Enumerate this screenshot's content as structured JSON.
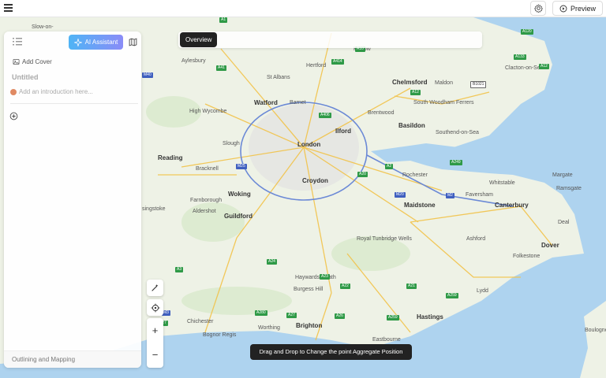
{
  "topbar": {
    "menu_icon": "hamburger-icon",
    "settings_icon": "gear-icon",
    "preview_label": "Preview",
    "preview_icon": "play-circle-icon"
  },
  "overview": {
    "label": "Overview"
  },
  "panel": {
    "outline_icon": "list-icon",
    "ai_assistant_label": "AI Assistant",
    "ai_icon": "sparkle-icon",
    "map_icon": "map-icon",
    "add_cover_label": "Add Cover",
    "title_placeholder": "Untitled",
    "intro_placeholder": "Add an introduction here...",
    "add_icon": "plus-circle-icon",
    "footer_label": "Outlining and Mapping"
  },
  "controls": {
    "draw_icon": "magic-wand-icon",
    "locate_icon": "crosshair-icon",
    "zoom_in": "+",
    "zoom_out": "−"
  },
  "tooltip": "Drag and Drop to Change the point Aggregate Position",
  "map": {
    "places": [
      {
        "name": "Aylesbury",
        "cls": ""
      },
      {
        "name": "St Albans",
        "cls": ""
      },
      {
        "name": "Hertford",
        "cls": ""
      },
      {
        "name": "Harlow",
        "cls": ""
      },
      {
        "name": "Chelmsford",
        "cls": "big"
      },
      {
        "name": "Maldon",
        "cls": ""
      },
      {
        "name": "Clacton-on-Sea",
        "cls": ""
      },
      {
        "name": "Watford",
        "cls": "big"
      },
      {
        "name": "Barnet",
        "cls": ""
      },
      {
        "name": "South Woodham Ferrers",
        "cls": ""
      },
      {
        "name": "High Wycombe",
        "cls": ""
      },
      {
        "name": "Brentwood",
        "cls": ""
      },
      {
        "name": "Ilford",
        "cls": "big"
      },
      {
        "name": "Basildon",
        "cls": "big"
      },
      {
        "name": "Southend-on-Sea",
        "cls": ""
      },
      {
        "name": "Slough",
        "cls": ""
      },
      {
        "name": "London",
        "cls": "big"
      },
      {
        "name": "Reading",
        "cls": "big"
      },
      {
        "name": "Bracknell",
        "cls": ""
      },
      {
        "name": "Croydon",
        "cls": "big"
      },
      {
        "name": "Rochester",
        "cls": ""
      },
      {
        "name": "Margate",
        "cls": ""
      },
      {
        "name": "Woking",
        "cls": "big"
      },
      {
        "name": "Whitstable",
        "cls": ""
      },
      {
        "name": "Ramsgate",
        "cls": ""
      },
      {
        "name": "Farnborough",
        "cls": ""
      },
      {
        "name": "Faversham",
        "cls": ""
      },
      {
        "name": "singstoke",
        "cls": ""
      },
      {
        "name": "Aldershot",
        "cls": ""
      },
      {
        "name": "Guildford",
        "cls": "big"
      },
      {
        "name": "Maidstone",
        "cls": "big"
      },
      {
        "name": "Canterbury",
        "cls": "big"
      },
      {
        "name": "Deal",
        "cls": ""
      },
      {
        "name": "Royal Tunbridge Wells",
        "cls": ""
      },
      {
        "name": "Ashford",
        "cls": ""
      },
      {
        "name": "Dover",
        "cls": "big"
      },
      {
        "name": "Folkestone",
        "cls": ""
      },
      {
        "name": "Haywards Heath",
        "cls": ""
      },
      {
        "name": "Burgess Hill",
        "cls": ""
      },
      {
        "name": "Lydd",
        "cls": ""
      },
      {
        "name": "Chichester",
        "cls": ""
      },
      {
        "name": "Worthing",
        "cls": ""
      },
      {
        "name": "Brighton",
        "cls": "big"
      },
      {
        "name": "Hastings",
        "cls": "big"
      },
      {
        "name": "Bognor Regis",
        "cls": ""
      },
      {
        "name": "Eastbourne",
        "cls": ""
      },
      {
        "name": "Boulogne-sur-Mer",
        "cls": ""
      },
      {
        "name": "Slow-on-",
        "cls": ""
      }
    ],
    "roads": [
      {
        "name": "A1",
        "cls": ""
      },
      {
        "name": "A10",
        "cls": ""
      },
      {
        "name": "A120",
        "cls": ""
      },
      {
        "name": "A12",
        "cls": ""
      },
      {
        "name": "A133",
        "cls": ""
      },
      {
        "name": "A41",
        "cls": ""
      },
      {
        "name": "A414",
        "cls": ""
      },
      {
        "name": "M40",
        "cls": "blue"
      },
      {
        "name": "A12",
        "cls": ""
      },
      {
        "name": "B1021",
        "cls": "white"
      },
      {
        "name": "A406",
        "cls": ""
      },
      {
        "name": "M25",
        "cls": "blue"
      },
      {
        "name": "A249",
        "cls": ""
      },
      {
        "name": "A20",
        "cls": ""
      },
      {
        "name": "A2",
        "cls": ""
      },
      {
        "name": "M20",
        "cls": "blue"
      },
      {
        "name": "M2",
        "cls": "blue"
      },
      {
        "name": "A24",
        "cls": ""
      },
      {
        "name": "A3",
        "cls": ""
      },
      {
        "name": "A23",
        "cls": ""
      },
      {
        "name": "A21",
        "cls": ""
      },
      {
        "name": "A259",
        "cls": ""
      },
      {
        "name": "A280",
        "cls": ""
      },
      {
        "name": "A27",
        "cls": ""
      },
      {
        "name": "A26",
        "cls": ""
      },
      {
        "name": "A259",
        "cls": ""
      },
      {
        "name": "A22",
        "cls": ""
      },
      {
        "name": "M3",
        "cls": "blue"
      },
      {
        "name": "A27",
        "cls": ""
      }
    ]
  },
  "colors": {
    "land": "#eef2e6",
    "sea": "#aed3ef",
    "ai_gradient_start": "#4fb4f5",
    "ai_gradient_end": "#8a8cf7",
    "tooltip_bg": "#222222"
  }
}
